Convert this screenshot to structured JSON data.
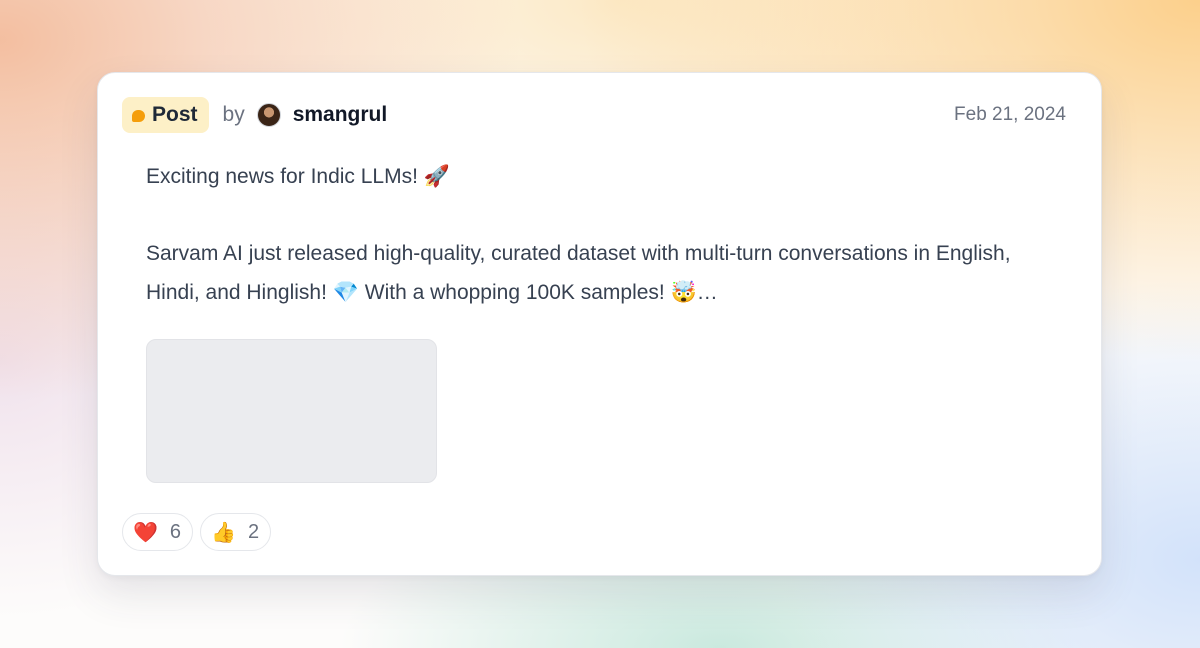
{
  "post": {
    "badge_label": "Post",
    "by_label": "by",
    "author": "smangrul",
    "date": "Feb 21, 2024",
    "line1_text": "Exciting news for Indic LLMs! ",
    "line1_emoji": "🚀",
    "para2_part1": "Sarvam AI just released high-quality, curated dataset with multi-turn conversations in English, Hindi, and Hinglish! ",
    "para2_emoji1": "💎",
    "para2_part2": " With a whopping 100K samples! ",
    "para2_emoji2": "🤯",
    "para2_ellipsis": "…"
  },
  "reactions": [
    {
      "emoji": "❤️",
      "count": "6",
      "icon": "heart-icon"
    },
    {
      "emoji": "👍",
      "count": "2",
      "icon": "thumbs-up-icon"
    }
  ],
  "colors": {
    "badge_bg": "#fdf0c7",
    "badge_dot": "#f59e0b",
    "card_bg": "#ffffff"
  }
}
